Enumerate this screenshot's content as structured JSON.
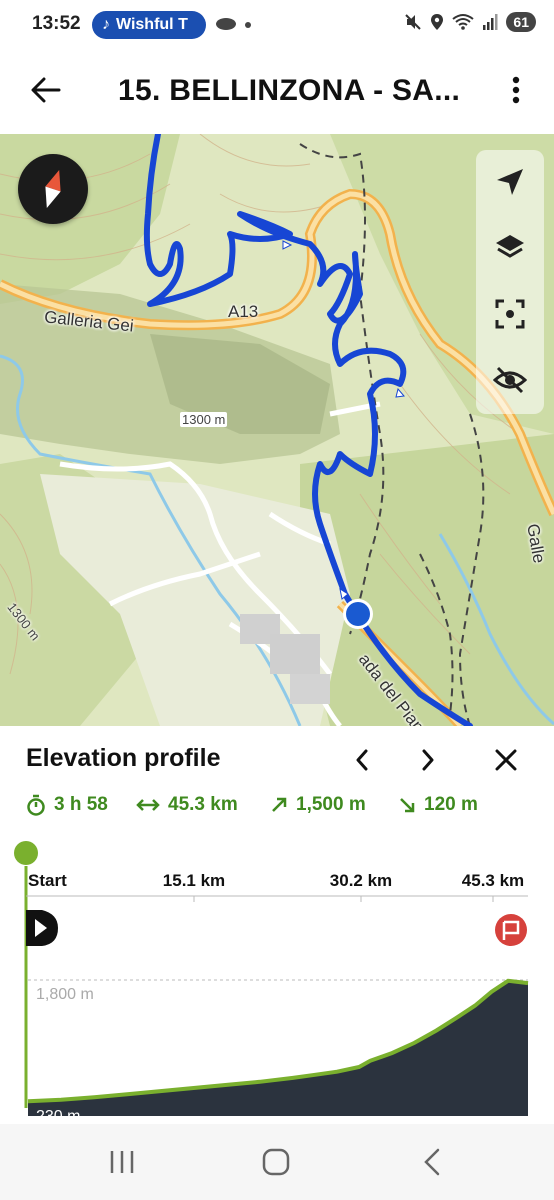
{
  "status_bar": {
    "time": "13:52",
    "media_app": "Wishful T",
    "battery": "61"
  },
  "header": {
    "title": "15. BELLINZONA - SA..."
  },
  "map": {
    "labels": {
      "road_tunnel": "Galleria Gei",
      "road_number": "A13",
      "contour_1": "1300 m",
      "contour_2": "1300 m",
      "street": "ada del Pian",
      "tunnel_right": "Galle"
    },
    "route_color": "#1746d4",
    "accent_color": "#1a5ad1"
  },
  "elevation": {
    "title": "Elevation profile",
    "stats": {
      "duration": "3 h 58",
      "distance": "45.3 km",
      "ascent": "1,500 m",
      "descent": "120 m"
    },
    "colors": {
      "accent": "#3f8a1f",
      "fill": "#2b333e",
      "end_marker": "#d6413c"
    }
  },
  "chart_data": {
    "type": "area",
    "title": "Elevation profile",
    "xlabel": "",
    "ylabel": "",
    "x_ticks": [
      "Start",
      "15.1 km",
      "30.2 km",
      "45.3 km"
    ],
    "y_ticks": [
      "1,800 m",
      "230 m"
    ],
    "xlim": [
      0,
      45.3
    ],
    "ylim": [
      230,
      1800
    ],
    "series": [
      {
        "x": [
          0,
          3,
          6,
          9,
          12,
          15,
          18,
          21,
          24,
          26,
          28,
          30,
          31,
          33,
          35,
          37,
          39,
          40.5,
          42,
          43.5,
          45.3
        ],
        "y": [
          240,
          260,
          290,
          330,
          370,
          410,
          450,
          490,
          540,
          580,
          620,
          680,
          760,
          860,
          990,
          1150,
          1330,
          1470,
          1650,
          1790,
          1760
        ]
      }
    ]
  },
  "nav_bar": {
    "recents": "recents",
    "home": "home",
    "back": "back"
  }
}
